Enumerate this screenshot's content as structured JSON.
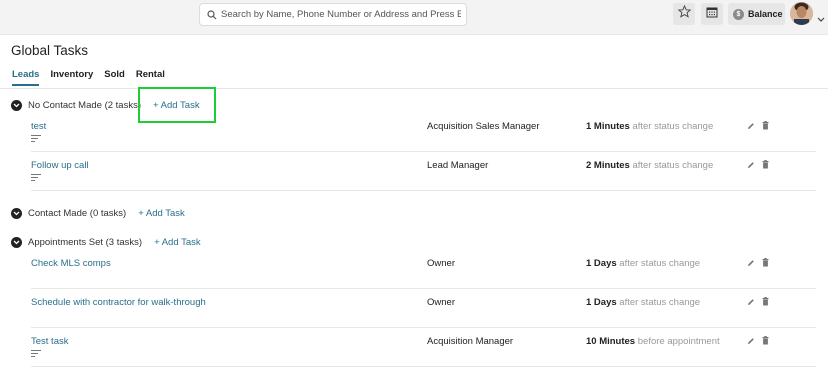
{
  "header": {
    "search_placeholder": "Search by Name, Phone Number or Address and Press Enter",
    "balance_label": "Balance",
    "balance_coin_symbol": "$",
    "icons": [
      "search-icon",
      "star-icon",
      "calendar-icon",
      "dollar-coin-icon",
      "avatar",
      "chevron-down-icon"
    ]
  },
  "page": {
    "title": "Global Tasks"
  },
  "tabs": [
    {
      "label": "Leads",
      "active": true
    },
    {
      "label": "Inventory",
      "active": false
    },
    {
      "label": "Sold",
      "active": false
    },
    {
      "label": "Rental",
      "active": false
    }
  ],
  "groups": [
    {
      "title": "No Contact Made (2 tasks)",
      "add_label": "+ Add Task",
      "tasks": [
        {
          "name": "test",
          "role": "Acquisition Sales Manager",
          "amount": "1 Minutes",
          "relation": "after status change",
          "has_description": true
        },
        {
          "name": "Follow up call",
          "role": "Lead Manager",
          "amount": "2 Minutes",
          "relation": "after status change",
          "has_description": true
        }
      ]
    },
    {
      "title": "Contact Made (0 tasks)",
      "add_label": "+ Add Task",
      "tasks": []
    },
    {
      "title": "Appointments Set (3 tasks)",
      "add_label": "+ Add Task",
      "tasks": [
        {
          "name": "Check MLS comps",
          "role": "Owner",
          "amount": "1 Days",
          "relation": "after status change",
          "has_description": false
        },
        {
          "name": "Schedule with contractor for walk-through",
          "role": "Owner",
          "amount": "1 Days",
          "relation": "after status change",
          "has_description": false
        },
        {
          "name": "Test task",
          "role": "Acquisition Manager",
          "amount": "10 Minutes",
          "relation": "before appointment",
          "has_description": true
        }
      ]
    }
  ],
  "colors": {
    "accent": "#2a6f8a",
    "highlight": "#1fcc35",
    "muted": "#999999"
  }
}
